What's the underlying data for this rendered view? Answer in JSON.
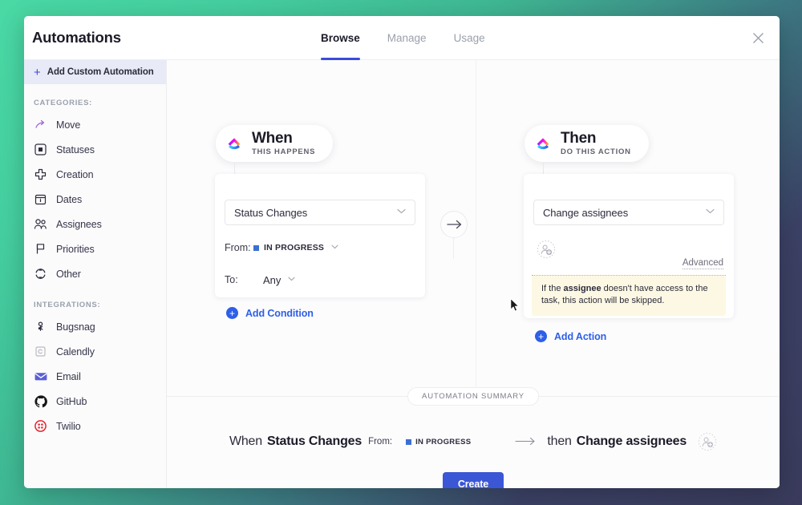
{
  "header": {
    "title": "Automations",
    "tabs": [
      {
        "label": "Browse",
        "active": true
      },
      {
        "label": "Manage",
        "active": false
      },
      {
        "label": "Usage",
        "active": false
      }
    ],
    "close_icon": "close-icon"
  },
  "sidebar": {
    "add_custom": {
      "label": "Add Custom Automation",
      "icon": "plus-icon"
    },
    "categories_header": "CATEGORIES:",
    "categories": [
      {
        "label": "Move",
        "icon": "move-arrow-icon"
      },
      {
        "label": "Statuses",
        "icon": "status-square-icon"
      },
      {
        "label": "Creation",
        "icon": "plus-cross-icon"
      },
      {
        "label": "Dates",
        "icon": "calendar-icon"
      },
      {
        "label": "Assignees",
        "icon": "people-icon"
      },
      {
        "label": "Priorities",
        "icon": "flag-icon"
      },
      {
        "label": "Other",
        "icon": "sync-icon"
      }
    ],
    "integrations_header": "INTEGRATIONS:",
    "integrations": [
      {
        "label": "Bugsnag",
        "icon": "bugsnag-icon"
      },
      {
        "label": "Calendly",
        "icon": "calendly-icon"
      },
      {
        "label": "Email",
        "icon": "email-icon"
      },
      {
        "label": "GitHub",
        "icon": "github-icon"
      },
      {
        "label": "Twilio",
        "icon": "twilio-icon"
      }
    ]
  },
  "builder": {
    "when": {
      "pill_title": "When",
      "pill_subtitle": "THIS HAPPENS",
      "logo_icon": "clickup-logo-icon",
      "trigger_value": "Status Changes",
      "from_label": "From:",
      "from_value": "IN PROGRESS",
      "from_color": "#3b6fd4",
      "to_label": "To:",
      "to_value": "Any",
      "add_condition_label": "Add Condition"
    },
    "arrow_icon": "arrow-right-icon",
    "then": {
      "pill_title": "Then",
      "pill_subtitle": "DO THIS ACTION",
      "logo_icon": "clickup-logo-icon",
      "action_value": "Change assignees",
      "assignee_placeholder_icon": "add-assignee-icon",
      "advanced_label": "Advanced",
      "warning_prefix": "If the ",
      "warning_bold": "assignee",
      "warning_suffix": " doesn't have access to the task, this action will be skipped.",
      "add_action_label": "Add Action"
    }
  },
  "summary": {
    "badge": "AUTOMATION SUMMARY",
    "when_word": "When",
    "trigger": "Status Changes",
    "from_label": "From:",
    "status": "IN PROGRESS",
    "status_color": "#3b6fd4",
    "arrow_icon": "arrow-right-icon",
    "then_word": "then",
    "action": "Change assignees",
    "avatar_icon": "add-assignee-icon",
    "create_label": "Create"
  },
  "theme": {
    "accent": "#3b4bdb",
    "primary_button": "#3b57d6",
    "link": "#2e5fe8",
    "warning_bg": "#fdf8e3",
    "warning_border": "#d8b45a",
    "bg_gradient_start": "#4ad9a5",
    "bg_gradient_end": "#3a3b5c"
  }
}
